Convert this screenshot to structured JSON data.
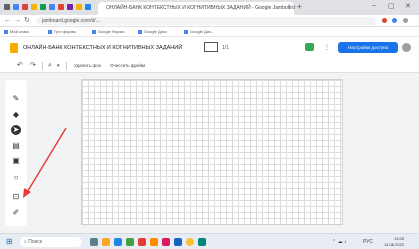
{
  "browser": {
    "tab_title": "ОНЛАЙН-БАНК КОНТЕКСТНЫХ И КОГНИТИВНЫХ ЗАДАНИЙ - Google Jamboard",
    "tab_close": "×",
    "new_tab": "+",
    "window_controls": [
      "–",
      "▢",
      "✕"
    ],
    "url": "jamboard.google.com/d/...",
    "bookmarks": [
      "Мой класс",
      "Гугл формы",
      "Google Форма",
      "Google Диск",
      "Google Дис..."
    ]
  },
  "app": {
    "title": "ОНЛАЙН-БАНК КОНТЕКСТНЫХ И КОГНИТИВНЫХ ЗАДАНИЙ",
    "frame_counter": "1/1",
    "share_label": "Настройки доступа",
    "icons": [
      "google-jamboard-logo",
      "meet-camera-icon",
      "more-options-icon"
    ]
  },
  "toolbar": {
    "clear_label": "Удалить фон",
    "set_bg_label": "Очистить фрейм"
  },
  "tools": [
    "pen",
    "eraser",
    "select",
    "sticky-note",
    "image",
    "circle",
    "text-box",
    "laser"
  ],
  "taskbar": {
    "search_placeholder": "Поиск",
    "lang": "РУС",
    "time": "13:03",
    "date": "14.08.2023"
  },
  "colors": {
    "accent": "#1a73e8",
    "logo": "#f9ab00",
    "annotation_arrow": "#e53935"
  }
}
